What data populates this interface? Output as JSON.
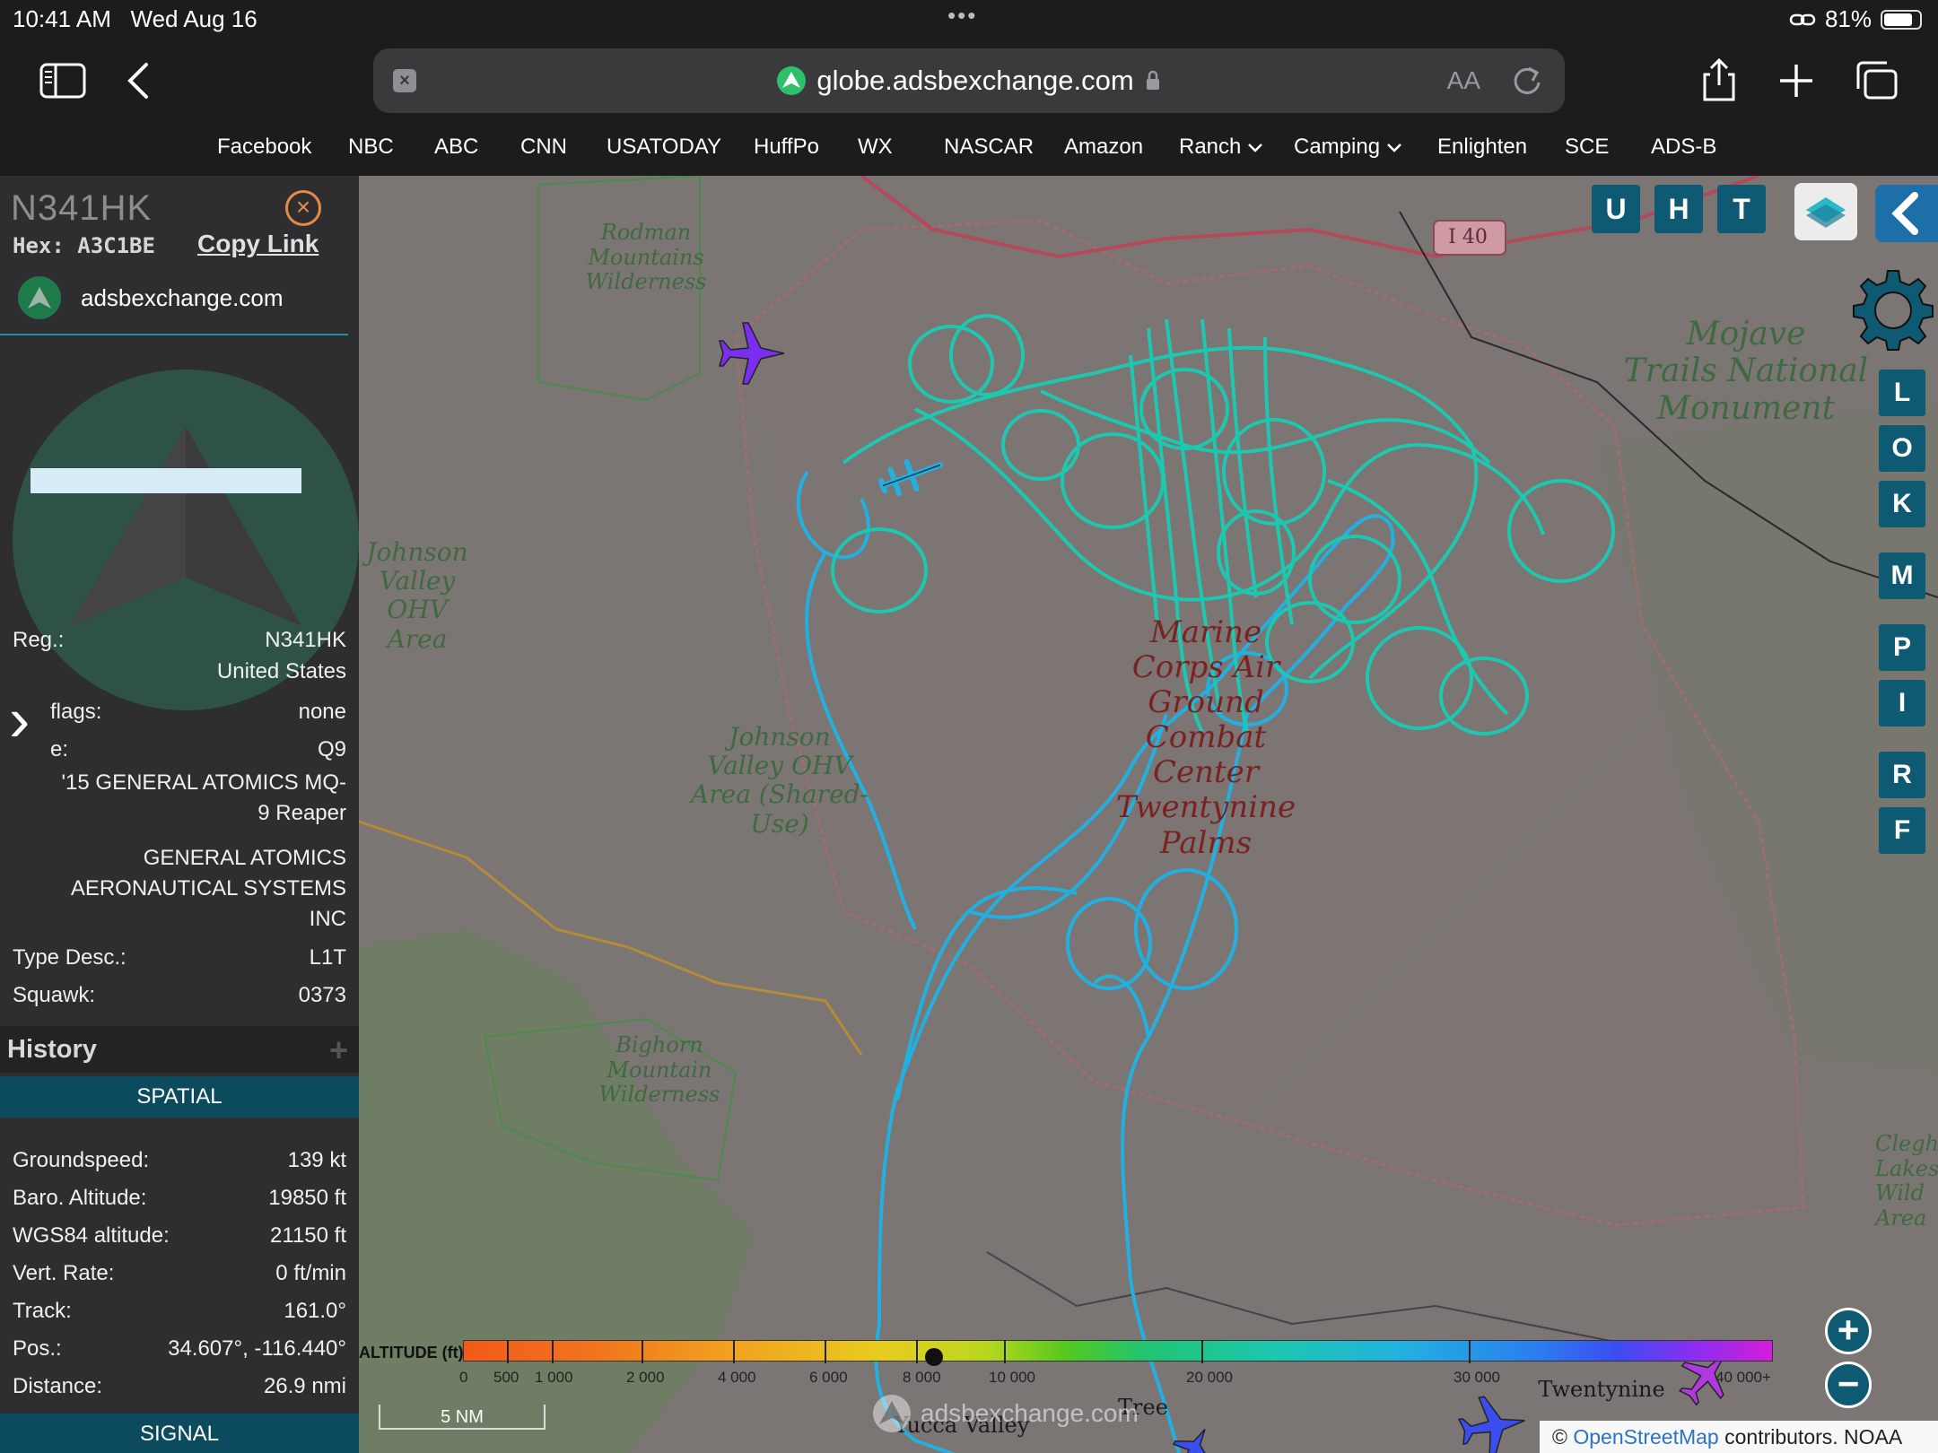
{
  "status": {
    "time": "10:41 AM",
    "date": "Wed Aug 16",
    "battery": "81%",
    "battery_level": 0.81
  },
  "browser": {
    "url": "globe.adsbexchange.com",
    "reader_label": "AA",
    "bookmarks": [
      "Facebook",
      "NBC",
      "ABC",
      "CNN",
      "USATODAY",
      "HuffPo",
      "WX",
      "NASCAR",
      "Amazon",
      "Ranch",
      "Camping",
      "Enlighten",
      "SCE",
      "ADS-B"
    ]
  },
  "aircraft": {
    "callsign": "N341HK",
    "hex_label": "Hex:",
    "hex": "A3C1BE",
    "copy_link": "Copy Link",
    "site": "adsbexchange.com",
    "reg_label": "Reg.:",
    "reg": "N341HK",
    "country": "United States",
    "flags_label": "flags:",
    "flags": "none",
    "type_label": "e:",
    "type": "Q9",
    "model_line1": "'15 GENERAL ATOMICS MQ-",
    "model_line2": "9 Reaper",
    "owner_line1": "GENERAL ATOMICS",
    "owner_line2": "AERONAUTICAL SYSTEMS",
    "owner_line3": "INC",
    "type_desc_label": "Type Desc.:",
    "type_desc": "L1T",
    "squawk_label": "Squawk:",
    "squawk": "0373"
  },
  "history": {
    "title": "History",
    "plus": "+",
    "spatial": "SPATIAL",
    "signal": "SIGNAL",
    "stats": [
      {
        "label": "Groundspeed:",
        "value": "139 kt"
      },
      {
        "label": "Baro. Altitude:",
        "value": "19850 ft"
      },
      {
        "label": "WGS84 altitude:",
        "value": "21150 ft"
      },
      {
        "label": "Vert. Rate:",
        "value": "0 ft/min"
      },
      {
        "label": "Track:",
        "value": "161.0°"
      },
      {
        "label": "Pos.:",
        "value": "34.607°, -116.440°"
      },
      {
        "label": "Distance:",
        "value": "26.9 nmi"
      }
    ]
  },
  "map": {
    "labels": {
      "rodman": "Rodman\nMountains\nWilderness",
      "mojave": "Mojave\nTrails National\nMonument",
      "johnson1": "Johnson\nValley OHV\nArea",
      "johnson2": "Johnson\nValley OHV\nArea (Shared-\nUse)",
      "marine": "Marine\nCorps Air\nGround\nCombat\nCenter\nTwentynine\nPalms",
      "bighorn": "Bighorn\nMountain\nWilderness",
      "clegh": "Clegh\nLakes Wild\nArea",
      "i40": "I 40",
      "yucca": "Yucca Valley",
      "tree": "Tree",
      "twentynine": "Twentynine"
    },
    "top_buttons": [
      "U",
      "H",
      "T"
    ],
    "side_buttons": [
      "L",
      "O",
      "K",
      "M",
      "P",
      "I",
      "R",
      "F"
    ],
    "altitude_title": "ALTITUDE (ft)",
    "altitude_ticks": [
      "0",
      "500",
      "1 000",
      "2 000",
      "4 000",
      "6 000",
      "8 000",
      "10 000",
      "20 000",
      "30 000",
      "40 000+"
    ],
    "scale": "5 NM",
    "watermark": "adsbexchange.com",
    "attribution_prefix": "©",
    "attribution_link": "OpenStreetMap",
    "attribution_suffix": "contributors. NOAA",
    "zoom_in": "+",
    "zoom_out": "−"
  },
  "colors": {
    "accent": "#0d5a72",
    "track_high": "#1dc7b0",
    "track_low": "#22b0e0",
    "aircraft": "#7a2ef2"
  }
}
